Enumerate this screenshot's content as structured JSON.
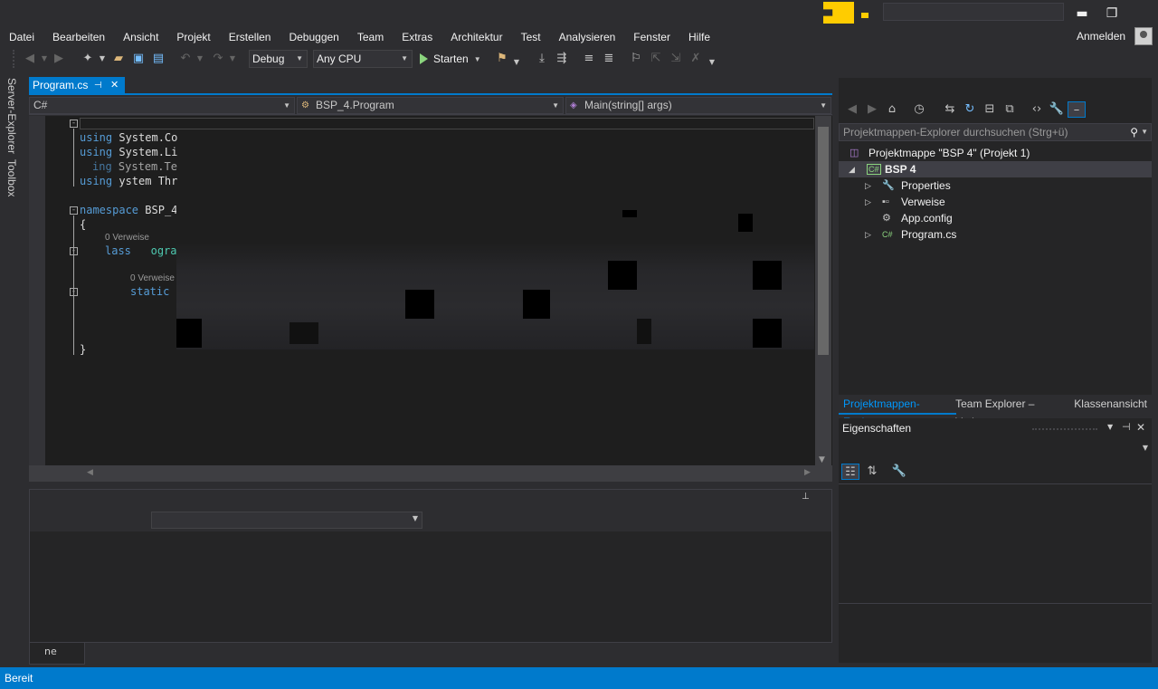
{
  "window": {
    "minimize": "▬",
    "restore": "❐"
  },
  "menu": {
    "items": [
      "Datei",
      "Bearbeiten",
      "Ansicht",
      "Projekt",
      "Erstellen",
      "Debuggen",
      "Team",
      "Extras",
      "Architektur",
      "Test",
      "Analysieren",
      "Fenster",
      "Hilfe"
    ],
    "sign_in": "Anmelden"
  },
  "toolbar": {
    "configuration": "Debug",
    "platform": "Any CPU",
    "start_label": "Starten"
  },
  "side_tabs": {
    "server_explorer": "Server-Explorer",
    "toolbox": "Toolbox"
  },
  "document": {
    "tab_label": "Program.cs",
    "pin_glyph": "⊣",
    "close_glyph": "✕"
  },
  "navbar": {
    "project": "C#",
    "class": "BSP_4.Program",
    "member": "Main(string[] args)"
  },
  "code": {
    "using1_kw": "using",
    "using1_ns": "System.Co",
    "using2_kw": "using",
    "using2_ns": "System.Li",
    "using3_kw": "ing",
    "using3_ns": "System.Te",
    "using4_kw": "using",
    "using4_ns": "ystem Thr",
    "namespace_kw": "namespace",
    "namespace_name": "BSP_4",
    "open_brace": "{",
    "ref_class": "0 Verweise",
    "class_kw": "lass",
    "class_name": "ogra",
    "ref_method": "0 Verweise",
    "static_kw": "static",
    "close_brace": "}"
  },
  "solution_explorer": {
    "search_placeholder": "Projektmappen-Explorer durchsuchen (Strg+ü)",
    "solution": "Projektmappe \"BSP 4\" (Projekt 1)",
    "project": "BSP 4",
    "items": [
      {
        "label": "Properties",
        "icon": "wrench-icon",
        "expandable": true
      },
      {
        "label": "Verweise",
        "icon": "references-icon",
        "expandable": true
      },
      {
        "label": "App.config",
        "icon": "config-icon",
        "expandable": false
      },
      {
        "label": "Program.cs",
        "icon": "csharp-file-icon",
        "expandable": true
      }
    ],
    "tabs": [
      "Projektmappen-Expl...",
      "Team Explorer – Verb...",
      "Klassenansicht"
    ]
  },
  "properties": {
    "title": "Eigenschaften"
  },
  "status": {
    "text": "Bereit"
  },
  "bottom": {
    "tab_label": "ne"
  },
  "colors": {
    "accent": "#007acc",
    "keyword": "#569cd6",
    "type": "#4ec9b0",
    "background": "#2d2d30",
    "editor": "#1e1e1e"
  }
}
